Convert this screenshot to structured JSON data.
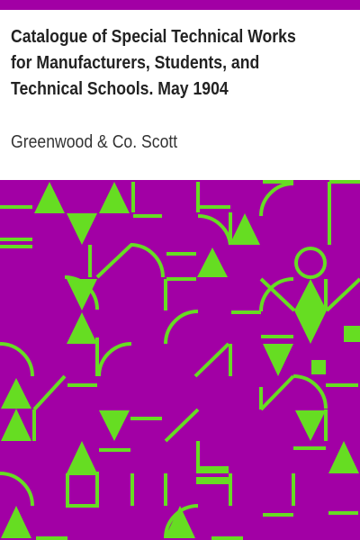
{
  "cover": {
    "title_lines": [
      "Catalogue of Special Technical Works",
      "for Manufacturers, Students, and",
      "Technical Schools. May 1904"
    ],
    "author": "Greenwood & Co. Scott",
    "colors": {
      "accent": "#a200a5",
      "pattern_fg": "#66dd22",
      "text": "#222222"
    }
  }
}
